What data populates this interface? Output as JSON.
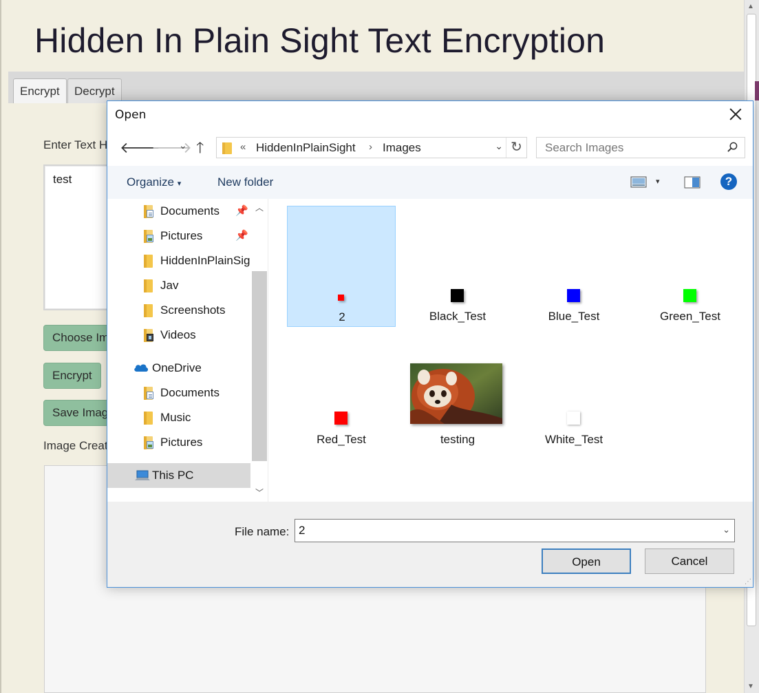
{
  "app": {
    "title": "Hidden In Plain Sight Text Encryption",
    "tabs": [
      {
        "label": "Encrypt",
        "active": true
      },
      {
        "label": "Decrypt",
        "active": false
      }
    ],
    "enter_text_label": "Enter Text H",
    "textarea_value": "test",
    "buttons": {
      "choose_image": "Choose Im",
      "encrypt": "Encrypt",
      "save_image": "Save Imag"
    },
    "image_created_label": "Image Creat",
    "accent_color": "#8fbf9e"
  },
  "dialog": {
    "title": "Open",
    "address": {
      "overflow_glyph": "«",
      "crumbs": [
        "HiddenInPlainSight",
        "Images"
      ],
      "separator": "›"
    },
    "search": {
      "placeholder": "Search Images"
    },
    "toolbar": {
      "organize": "Organize",
      "new_folder": "New folder",
      "help_glyph": "?"
    },
    "nav": {
      "quick_access": [
        {
          "label": "Documents",
          "icon": "documents-folder-icon",
          "pinned": true
        },
        {
          "label": "Pictures",
          "icon": "pictures-folder-icon",
          "pinned": true
        },
        {
          "label": "HiddenInPlainSig",
          "icon": "folder-icon",
          "pinned": false
        },
        {
          "label": "Jav",
          "icon": "folder-icon",
          "pinned": false
        },
        {
          "label": "Screenshots",
          "icon": "folder-icon",
          "pinned": false
        },
        {
          "label": "Videos",
          "icon": "videos-folder-icon",
          "pinned": false
        }
      ],
      "onedrive": {
        "label": "OneDrive",
        "items": [
          {
            "label": "Documents",
            "icon": "documents-folder-icon"
          },
          {
            "label": "Music",
            "icon": "music-folder-icon"
          },
          {
            "label": "Pictures",
            "icon": "pictures-folder-icon"
          }
        ]
      },
      "this_pc": {
        "label": "This PC",
        "selected": true
      }
    },
    "files": [
      {
        "name": "2",
        "color": "#ff0000",
        "selected": true
      },
      {
        "name": "Black_Test",
        "color": "#000000",
        "selected": false
      },
      {
        "name": "Blue_Test",
        "color": "#0000ff",
        "selected": false
      },
      {
        "name": "Green_Test",
        "color": "#00ff00",
        "selected": false
      },
      {
        "name": "Red_Test",
        "color": "#ff0000",
        "selected": false
      },
      {
        "name": "testing",
        "color": "photo-red-panda",
        "selected": false
      },
      {
        "name": "White_Test",
        "color": "#ffffff",
        "selected": false
      }
    ],
    "footer": {
      "file_name_label": "File name:",
      "file_name_value": "2",
      "open_button": "Open",
      "cancel_button": "Cancel"
    },
    "selection_color": "#cce8ff",
    "border_color": "#4a90d8"
  }
}
